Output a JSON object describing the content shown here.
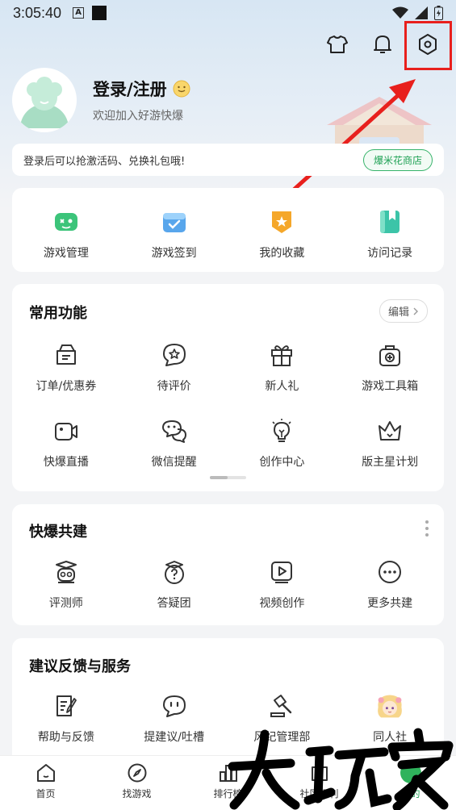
{
  "status_bar": {
    "time": "3:05:40",
    "badge": "A"
  },
  "profile": {
    "login_title": "登录/注册",
    "subtitle": "欢迎加入好游快爆"
  },
  "notice": {
    "text": "登录后可以抢激活码、兑换礼包哦!",
    "button": "爆米花商店"
  },
  "quick_items": [
    {
      "label": "游戏管理",
      "icon": "gamepad-icon"
    },
    {
      "label": "游戏签到",
      "icon": "calendar-check-icon"
    },
    {
      "label": "我的收藏",
      "icon": "star-badge-icon"
    },
    {
      "label": "访问记录",
      "icon": "bookmark-book-icon"
    }
  ],
  "common": {
    "title": "常用功能",
    "edit": "编辑",
    "items": [
      {
        "label": "订单/优惠券",
        "icon": "coupon-icon"
      },
      {
        "label": "待评价",
        "icon": "star-bubble-icon"
      },
      {
        "label": "新人礼",
        "icon": "gift-icon"
      },
      {
        "label": "游戏工具箱",
        "icon": "toolbox-icon"
      },
      {
        "label": "快爆直播",
        "icon": "video-camera-icon"
      },
      {
        "label": "微信提醒",
        "icon": "wechat-icon"
      },
      {
        "label": "创作中心",
        "icon": "lightbulb-icon"
      },
      {
        "label": "版主星计划",
        "icon": "crown-icon"
      }
    ]
  },
  "build": {
    "title": "快爆共建",
    "items": [
      {
        "label": "评测师",
        "icon": "reviewer-icon"
      },
      {
        "label": "答疑团",
        "icon": "question-icon"
      },
      {
        "label": "视频创作",
        "icon": "play-icon"
      },
      {
        "label": "更多共建",
        "icon": "more-icon"
      }
    ]
  },
  "feedback": {
    "title": "建议反馈与服务",
    "items": [
      {
        "label": "帮助与反馈",
        "icon": "help-doc-icon"
      },
      {
        "label": "提建议/吐槽",
        "icon": "chat-icon"
      },
      {
        "label": "风纪管理部",
        "icon": "gavel-icon"
      },
      {
        "label": "同人社",
        "icon": "anime-avatar-icon"
      }
    ]
  },
  "tabbar": [
    {
      "label": "首页",
      "icon": "home-icon"
    },
    {
      "label": "找游戏",
      "icon": "compass-icon"
    },
    {
      "label": "排行榜",
      "icon": "ranking-icon"
    },
    {
      "label": "社区福利",
      "icon": "community-icon"
    },
    {
      "label": "我的",
      "icon": "mine-icon"
    }
  ],
  "watermark": {
    "text": "大玩家"
  },
  "colors": {
    "accent_green": "#1ea154",
    "highlight_red": "#e8201d"
  }
}
